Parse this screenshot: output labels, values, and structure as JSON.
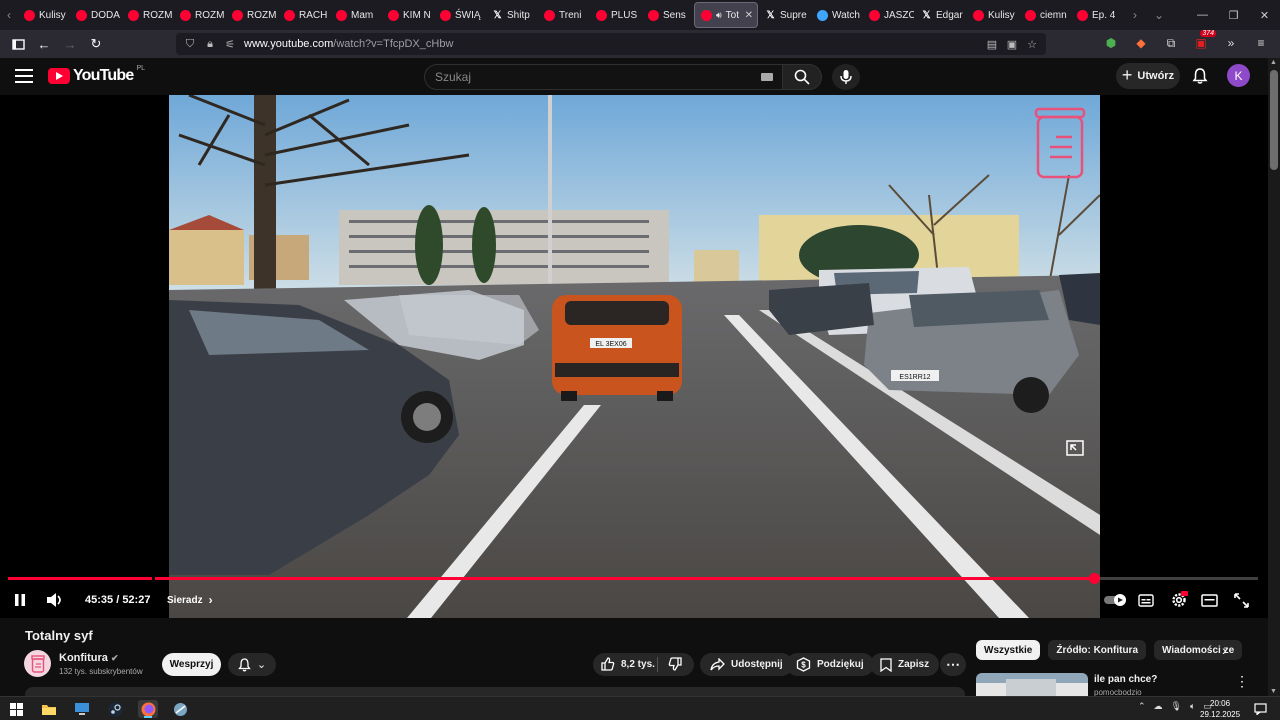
{
  "browser": {
    "tabs": [
      {
        "label": "Kulisy",
        "icon": "youtube-icon"
      },
      {
        "label": "DODA",
        "icon": "youtube-icon"
      },
      {
        "label": "ROZM",
        "icon": "youtube-icon"
      },
      {
        "label": "ROZM",
        "icon": "youtube-icon"
      },
      {
        "label": "ROZM",
        "icon": "youtube-icon"
      },
      {
        "label": "RACH",
        "icon": "youtube-icon"
      },
      {
        "label": "Mam",
        "icon": "youtube-icon"
      },
      {
        "label": "KIM N",
        "icon": "youtube-icon"
      },
      {
        "label": "ŚWIĄ",
        "icon": "youtube-icon"
      },
      {
        "label": "Shitp",
        "icon": "x-icon"
      },
      {
        "label": "Treni",
        "icon": "youtube-icon"
      },
      {
        "label": "PLUS",
        "icon": "youtube-icon"
      },
      {
        "label": "Sens",
        "icon": "youtube-icon"
      },
      {
        "label": "Tot",
        "icon": "youtube-icon",
        "active": true
      },
      {
        "label": "Supre",
        "icon": "x-icon"
      },
      {
        "label": "Watch",
        "icon": "chatgpt-icon"
      },
      {
        "label": "JASZC",
        "icon": "youtube-icon"
      },
      {
        "label": "Edgar",
        "icon": "x-icon"
      },
      {
        "label": "Kulisy",
        "icon": "youtube-icon"
      },
      {
        "label": "ciemn",
        "icon": "youtube-icon"
      },
      {
        "label": "Ep. 4",
        "icon": "youtube-icon"
      }
    ],
    "url_host": "www.youtube.com",
    "url_path": "/watch?v=TfcpDX_cHbw",
    "extension_badge": "374"
  },
  "youtube": {
    "logo_text": "YouTube",
    "region": "PL",
    "search_placeholder": "Szukaj",
    "create_label": "Utwórz",
    "avatar_letter": "K"
  },
  "player": {
    "current_time": "45:35",
    "duration": "52:27",
    "time_separator": " / ",
    "progress_fraction": 0.869,
    "chapter": "Sieradz",
    "plates": [
      "EL 3EX06",
      "ES1RR12"
    ]
  },
  "video": {
    "title": "Totalny syf",
    "channel": "Konfitura",
    "subscribers": "132 tys. subskrybentów",
    "support_label": "Wesprzyj",
    "likes": "8,2 tys.",
    "share_label": "Udostępnij",
    "thanks_label": "Podziękuj",
    "save_label": "Zapisz"
  },
  "sidebar": {
    "chips": [
      "Wszystkie",
      "Źródło: Konfitura",
      "Wiadomości ze"
    ],
    "rec_title": "ile pan chce?",
    "rec_channel": "pomocbodzio"
  },
  "taskbar": {
    "time": "20:06",
    "date": "29.12.2025"
  },
  "colors": {
    "accent": "#ff0033",
    "background": "#0f0f0f",
    "avatar": "#8f4ac9"
  }
}
